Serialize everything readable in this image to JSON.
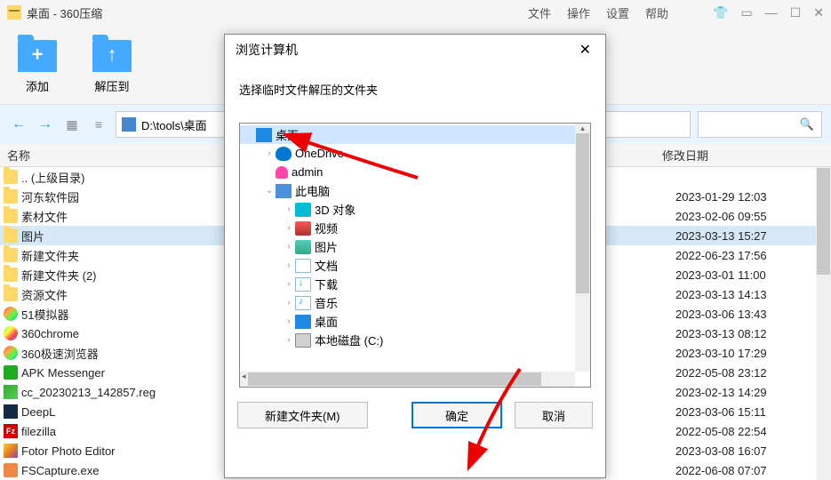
{
  "titlebar": {
    "title": "桌面 - 360压缩"
  },
  "menus": {
    "file": "文件",
    "operation": "操作",
    "settings": "设置",
    "help": "帮助"
  },
  "toolbar": {
    "add": "添加",
    "extract": "解压到"
  },
  "nav": {
    "path": "D:\\tools\\桌面"
  },
  "columns": {
    "name": "名称",
    "date": "修改日期"
  },
  "files": [
    {
      "icon": "folder",
      "name": ".. (上级目录)",
      "date": ""
    },
    {
      "icon": "folder",
      "name": "河东软件园",
      "date": "2023-01-29 12:03"
    },
    {
      "icon": "folder",
      "name": "素材文件",
      "date": "2023-02-06 09:55"
    },
    {
      "icon": "folder",
      "name": "图片",
      "date": "2023-03-13 15:27",
      "selected": true
    },
    {
      "icon": "folder",
      "name": "新建文件夹",
      "date": "2022-06-23 17:56"
    },
    {
      "icon": "folder",
      "name": "新建文件夹 (2)",
      "date": "2023-03-01 11:00"
    },
    {
      "icon": "folder",
      "name": "资源文件",
      "date": "2023-03-13 14:13"
    },
    {
      "icon": "app",
      "color": "linear-gradient(135deg,#f44,#fa4,#4f4,#48f)",
      "name": "51模拟器",
      "date": "2023-03-06 13:43"
    },
    {
      "icon": "app",
      "color": "linear-gradient(135deg,#4f4,#ff4,#f44,#48f)",
      "name": "360chrome",
      "date": "2023-03-13 08:12"
    },
    {
      "icon": "app",
      "color": "linear-gradient(135deg,#f44,#fa4,#4f4,#48f)",
      "name": "360极速浏览器",
      "date": "2023-03-10 17:29"
    },
    {
      "icon": "app",
      "color": "#2a2",
      "square": true,
      "name": "APK Messenger",
      "date": "2022-05-08 23:12"
    },
    {
      "icon": "reg",
      "name": "cc_20230213_142857.reg",
      "date": "2023-02-13 14:29"
    },
    {
      "icon": "deepl",
      "name": "DeepL",
      "date": "2023-03-06 15:11"
    },
    {
      "icon": "fz",
      "text": "Fz",
      "name": "filezilla",
      "date": "2022-05-08 22:54"
    },
    {
      "icon": "fotor",
      "name": "Fotor Photo Editor",
      "date": "2023-03-08 16:07"
    },
    {
      "icon": "app",
      "color": "#e84",
      "square": true,
      "name": "FSCapture.exe",
      "date": "2022-06-08 07:07"
    }
  ],
  "dialog": {
    "title": "浏览计算机",
    "prompt": "选择临时文件解压的文件夹",
    "btn_new": "新建文件夹(M)",
    "btn_ok": "确定",
    "btn_cancel": "取消"
  },
  "tree": [
    {
      "lvl": 0,
      "exp": "",
      "icon": "desktop",
      "label": "桌面",
      "selected": true
    },
    {
      "lvl": 1,
      "exp": ">",
      "icon": "onedrive",
      "label": "OneDrive"
    },
    {
      "lvl": 1,
      "exp": "",
      "icon": "user",
      "label": "admin"
    },
    {
      "lvl": 1,
      "exp": "v",
      "icon": "pc",
      "label": "此电脑"
    },
    {
      "lvl": 2,
      "exp": ">",
      "icon": "obj3d",
      "label": "3D 对象"
    },
    {
      "lvl": 2,
      "exp": ">",
      "icon": "video",
      "label": "视频"
    },
    {
      "lvl": 2,
      "exp": ">",
      "icon": "pic",
      "label": "图片"
    },
    {
      "lvl": 2,
      "exp": ">",
      "icon": "doc",
      "label": "文档"
    },
    {
      "lvl": 2,
      "exp": ">",
      "icon": "dl",
      "label": "下载"
    },
    {
      "lvl": 2,
      "exp": ">",
      "icon": "music",
      "label": "音乐"
    },
    {
      "lvl": 2,
      "exp": ">",
      "icon": "desktop",
      "label": "桌面"
    },
    {
      "lvl": 2,
      "exp": ">",
      "icon": "disk",
      "label": "本地磁盘 (C:)"
    }
  ]
}
